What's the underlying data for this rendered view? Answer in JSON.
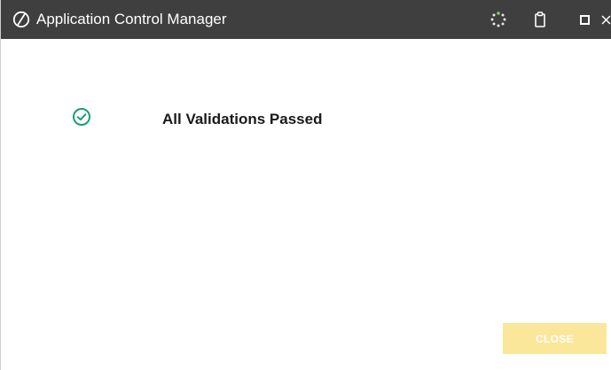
{
  "window": {
    "title": "Application Control Manager",
    "title_bar_color": "#3f3f3f"
  },
  "titlebar_icons": {
    "app": "app-logo-icon",
    "busy": "spinner-icon",
    "clipboard": "clipboard-icon",
    "maximize": "maximize-icon",
    "close": "close-icon"
  },
  "main": {
    "status_icon": "check-circle-icon",
    "status_icon_color": "#1a9e6e",
    "status_message": "All Validations Passed"
  },
  "footer": {
    "close_label": "CLOSE",
    "close_button_color": "#fbe79a",
    "close_enabled": false
  }
}
